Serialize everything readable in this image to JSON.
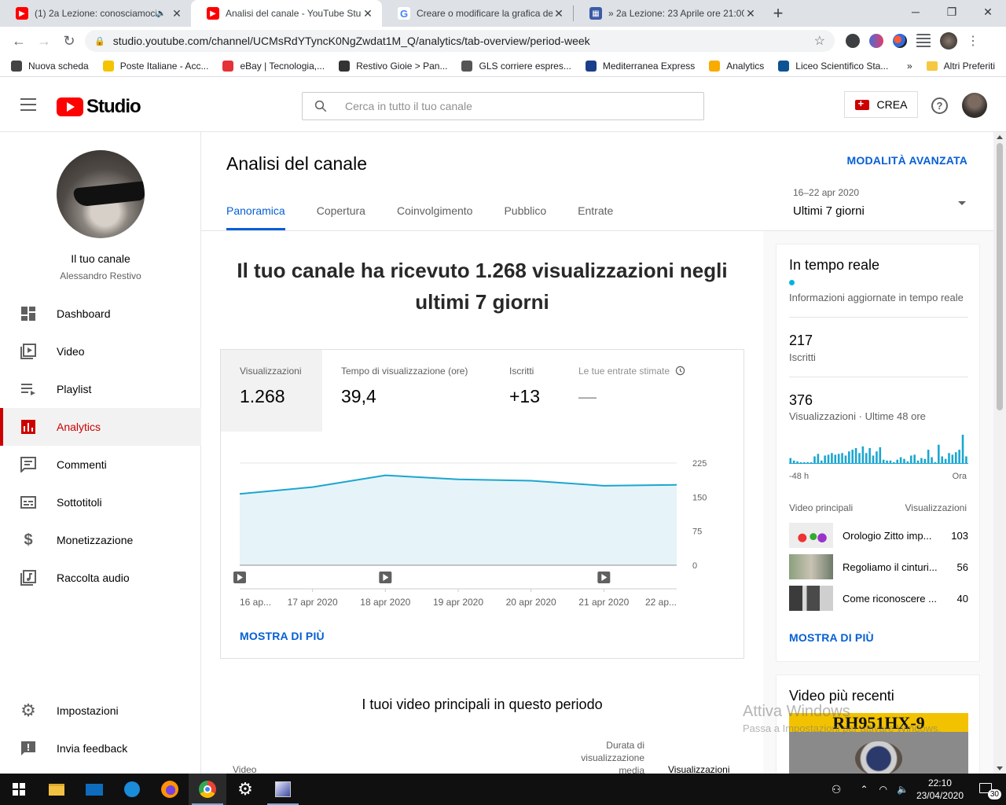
{
  "browser": {
    "tabs": [
      {
        "title": "(1) 2a Lezione: conosciamoci",
        "favicon": "youtube-icon",
        "audio": true,
        "active": false
      },
      {
        "title": "Analisi del canale - YouTube Studio",
        "favicon": "youtube-icon",
        "audio": false,
        "active": true
      },
      {
        "title": "Creare o modificare la grafica del",
        "favicon": "google-icon",
        "audio": false,
        "active": false
      },
      {
        "title": "» 2a Lezione: 23 Aprile ore 21:00",
        "favicon": "site-icon",
        "audio": false,
        "active": false
      }
    ],
    "url": "studio.youtube.com/channel/UCMsRdYTyncK0NgZwdat1M_Q/analytics/tab-overview/period-week",
    "bookmarks": [
      {
        "label": "Nuova scheda",
        "color": "#444"
      },
      {
        "label": "Poste Italiane - Acc...",
        "color": "#f5c400"
      },
      {
        "label": "eBay | Tecnologia,...",
        "color": "#e53238"
      },
      {
        "label": "Restivo Gioie > Pan...",
        "color": "#333"
      },
      {
        "label": "GLS corriere espres...",
        "color": "#555"
      },
      {
        "label": "Mediterranea Express",
        "color": "#1a3e8c"
      },
      {
        "label": "Analytics",
        "color": "#f9ab00"
      },
      {
        "label": "Liceo Scientifico Sta...",
        "color": "#0b5394"
      }
    ],
    "bookmarks_overflow": "»",
    "other_bookmarks": "Altri Preferiti"
  },
  "header": {
    "logo_text": "Studio",
    "search_placeholder": "Cerca in tutto il tuo canale",
    "create_label": "CREA"
  },
  "sidebar": {
    "channel_title": "Il tuo canale",
    "channel_name": "Alessandro Restivo",
    "items": [
      {
        "label": "Dashboard",
        "icon": "dashboard-icon",
        "active": false
      },
      {
        "label": "Video",
        "icon": "video-library-icon",
        "active": false
      },
      {
        "label": "Playlist",
        "icon": "playlist-icon",
        "active": false
      },
      {
        "label": "Analytics",
        "icon": "analytics-icon",
        "active": true
      },
      {
        "label": "Commenti",
        "icon": "comments-icon",
        "active": false
      },
      {
        "label": "Sottotitoli",
        "icon": "subtitles-icon",
        "active": false
      },
      {
        "label": "Monetizzazione",
        "icon": "dollar-icon",
        "active": false
      },
      {
        "label": "Raccolta audio",
        "icon": "audio-library-icon",
        "active": false
      }
    ],
    "bottom_items": [
      {
        "label": "Impostazioni",
        "icon": "gear-icon"
      },
      {
        "label": "Invia feedback",
        "icon": "feedback-icon"
      }
    ]
  },
  "main": {
    "title": "Analisi del canale",
    "advanced_mode": "MODALITÀ AVANZATA",
    "tabs": [
      "Panoramica",
      "Copertura",
      "Coinvolgimento",
      "Pubblico",
      "Entrate"
    ],
    "active_tab": "Panoramica",
    "period_dates": "16–22 apr 2020",
    "period_label": "Ultimi 7 giorni",
    "headline": "Il tuo canale ha ricevuto 1.268 visualizzazioni negli ultimi 7 giorni",
    "metrics": [
      {
        "label": "Visualizzazioni",
        "value": "1.268",
        "selected": true
      },
      {
        "label": "Tempo di visualizzazione (ore)",
        "value": "39,4",
        "selected": false
      },
      {
        "label": "Iscritti",
        "value": "+13",
        "selected": false
      },
      {
        "label": "Le tue entrate stimate",
        "value": "—",
        "selected": false
      }
    ],
    "show_more": "MOSTRA DI PIÙ",
    "top_videos_title": "I tuoi video principali in questo periodo",
    "table_headers": {
      "video": "Video",
      "avg_duration": "Durata di visualizzazione media",
      "views": "Visualizzazioni"
    }
  },
  "chart_data": {
    "type": "area",
    "x": [
      "16 ap...",
      "17 apr 2020",
      "18 apr 2020",
      "19 apr 2020",
      "20 apr 2020",
      "21 apr 2020",
      "22 ap..."
    ],
    "series": [
      {
        "values": [
          157,
          172,
          198,
          189,
          186,
          175,
          177
        ]
      }
    ],
    "ylim": [
      0,
      225
    ],
    "yticks": [
      "225",
      "150",
      "75",
      "0"
    ],
    "video_markers_at": [
      0,
      2,
      5
    ],
    "color": "#1ca6cf",
    "fill": "#e6f4f9"
  },
  "realtime": {
    "title": "In tempo reale",
    "subtitle": "Informazioni aggiornate in tempo reale",
    "subscribers": "217",
    "subscribers_label": "Iscritti",
    "views": "376",
    "views_label": "Visualizzazioni · Ultime 48 ore",
    "spark_left": "-48 h",
    "spark_right": "Ora",
    "spark_values": [
      6,
      3,
      2,
      1,
      0,
      1,
      0,
      8,
      11,
      3,
      9,
      10,
      12,
      10,
      11,
      12,
      9,
      14,
      16,
      18,
      12,
      20,
      12,
      18,
      9,
      14,
      19,
      4,
      3,
      3,
      1,
      4,
      7,
      5,
      2,
      9,
      10,
      3,
      6,
      5,
      16,
      7,
      0,
      22,
      8,
      5,
      12,
      10,
      13,
      16,
      34,
      8
    ],
    "top_videos_label": "Video principali",
    "views_col": "Visualizzazioni",
    "top_videos": [
      {
        "title": "Orologio Zitto imp...",
        "views": "103"
      },
      {
        "title": "Regoliamo il cinturi...",
        "views": "56"
      },
      {
        "title": "Come riconoscere ...",
        "views": "40"
      }
    ],
    "show_more": "MOSTRA DI PIÙ"
  },
  "recent": {
    "title": "Video più recenti",
    "thumb_text": "RH951HX-9"
  },
  "watermark": {
    "line1": "Attiva Windows",
    "line2": "Passa a Impostazioni per attivare Windows."
  },
  "taskbar": {
    "time": "22:10",
    "date": "23/04/2020",
    "notifications": "30"
  }
}
